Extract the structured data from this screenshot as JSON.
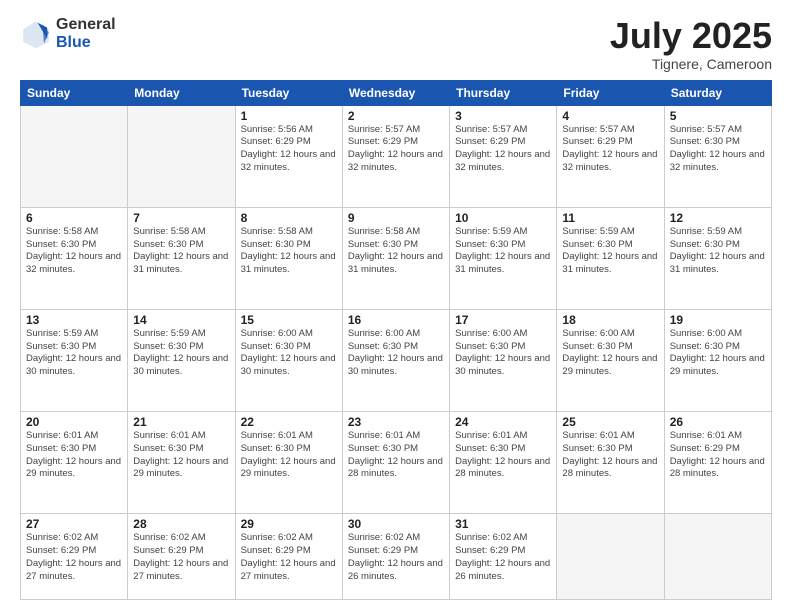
{
  "logo": {
    "general": "General",
    "blue": "Blue"
  },
  "header": {
    "month": "July 2025",
    "location": "Tignere, Cameroon"
  },
  "weekdays": [
    "Sunday",
    "Monday",
    "Tuesday",
    "Wednesday",
    "Thursday",
    "Friday",
    "Saturday"
  ],
  "weeks": [
    [
      {
        "day": "",
        "sunrise": "",
        "sunset": "",
        "daylight": ""
      },
      {
        "day": "",
        "sunrise": "",
        "sunset": "",
        "daylight": ""
      },
      {
        "day": "1",
        "sunrise": "Sunrise: 5:56 AM",
        "sunset": "Sunset: 6:29 PM",
        "daylight": "Daylight: 12 hours and 32 minutes."
      },
      {
        "day": "2",
        "sunrise": "Sunrise: 5:57 AM",
        "sunset": "Sunset: 6:29 PM",
        "daylight": "Daylight: 12 hours and 32 minutes."
      },
      {
        "day": "3",
        "sunrise": "Sunrise: 5:57 AM",
        "sunset": "Sunset: 6:29 PM",
        "daylight": "Daylight: 12 hours and 32 minutes."
      },
      {
        "day": "4",
        "sunrise": "Sunrise: 5:57 AM",
        "sunset": "Sunset: 6:29 PM",
        "daylight": "Daylight: 12 hours and 32 minutes."
      },
      {
        "day": "5",
        "sunrise": "Sunrise: 5:57 AM",
        "sunset": "Sunset: 6:30 PM",
        "daylight": "Daylight: 12 hours and 32 minutes."
      }
    ],
    [
      {
        "day": "6",
        "sunrise": "Sunrise: 5:58 AM",
        "sunset": "Sunset: 6:30 PM",
        "daylight": "Daylight: 12 hours and 32 minutes."
      },
      {
        "day": "7",
        "sunrise": "Sunrise: 5:58 AM",
        "sunset": "Sunset: 6:30 PM",
        "daylight": "Daylight: 12 hours and 31 minutes."
      },
      {
        "day": "8",
        "sunrise": "Sunrise: 5:58 AM",
        "sunset": "Sunset: 6:30 PM",
        "daylight": "Daylight: 12 hours and 31 minutes."
      },
      {
        "day": "9",
        "sunrise": "Sunrise: 5:58 AM",
        "sunset": "Sunset: 6:30 PM",
        "daylight": "Daylight: 12 hours and 31 minutes."
      },
      {
        "day": "10",
        "sunrise": "Sunrise: 5:59 AM",
        "sunset": "Sunset: 6:30 PM",
        "daylight": "Daylight: 12 hours and 31 minutes."
      },
      {
        "day": "11",
        "sunrise": "Sunrise: 5:59 AM",
        "sunset": "Sunset: 6:30 PM",
        "daylight": "Daylight: 12 hours and 31 minutes."
      },
      {
        "day": "12",
        "sunrise": "Sunrise: 5:59 AM",
        "sunset": "Sunset: 6:30 PM",
        "daylight": "Daylight: 12 hours and 31 minutes."
      }
    ],
    [
      {
        "day": "13",
        "sunrise": "Sunrise: 5:59 AM",
        "sunset": "Sunset: 6:30 PM",
        "daylight": "Daylight: 12 hours and 30 minutes."
      },
      {
        "day": "14",
        "sunrise": "Sunrise: 5:59 AM",
        "sunset": "Sunset: 6:30 PM",
        "daylight": "Daylight: 12 hours and 30 minutes."
      },
      {
        "day": "15",
        "sunrise": "Sunrise: 6:00 AM",
        "sunset": "Sunset: 6:30 PM",
        "daylight": "Daylight: 12 hours and 30 minutes."
      },
      {
        "day": "16",
        "sunrise": "Sunrise: 6:00 AM",
        "sunset": "Sunset: 6:30 PM",
        "daylight": "Daylight: 12 hours and 30 minutes."
      },
      {
        "day": "17",
        "sunrise": "Sunrise: 6:00 AM",
        "sunset": "Sunset: 6:30 PM",
        "daylight": "Daylight: 12 hours and 30 minutes."
      },
      {
        "day": "18",
        "sunrise": "Sunrise: 6:00 AM",
        "sunset": "Sunset: 6:30 PM",
        "daylight": "Daylight: 12 hours and 29 minutes."
      },
      {
        "day": "19",
        "sunrise": "Sunrise: 6:00 AM",
        "sunset": "Sunset: 6:30 PM",
        "daylight": "Daylight: 12 hours and 29 minutes."
      }
    ],
    [
      {
        "day": "20",
        "sunrise": "Sunrise: 6:01 AM",
        "sunset": "Sunset: 6:30 PM",
        "daylight": "Daylight: 12 hours and 29 minutes."
      },
      {
        "day": "21",
        "sunrise": "Sunrise: 6:01 AM",
        "sunset": "Sunset: 6:30 PM",
        "daylight": "Daylight: 12 hours and 29 minutes."
      },
      {
        "day": "22",
        "sunrise": "Sunrise: 6:01 AM",
        "sunset": "Sunset: 6:30 PM",
        "daylight": "Daylight: 12 hours and 29 minutes."
      },
      {
        "day": "23",
        "sunrise": "Sunrise: 6:01 AM",
        "sunset": "Sunset: 6:30 PM",
        "daylight": "Daylight: 12 hours and 28 minutes."
      },
      {
        "day": "24",
        "sunrise": "Sunrise: 6:01 AM",
        "sunset": "Sunset: 6:30 PM",
        "daylight": "Daylight: 12 hours and 28 minutes."
      },
      {
        "day": "25",
        "sunrise": "Sunrise: 6:01 AM",
        "sunset": "Sunset: 6:30 PM",
        "daylight": "Daylight: 12 hours and 28 minutes."
      },
      {
        "day": "26",
        "sunrise": "Sunrise: 6:01 AM",
        "sunset": "Sunset: 6:29 PM",
        "daylight": "Daylight: 12 hours and 28 minutes."
      }
    ],
    [
      {
        "day": "27",
        "sunrise": "Sunrise: 6:02 AM",
        "sunset": "Sunset: 6:29 PM",
        "daylight": "Daylight: 12 hours and 27 minutes."
      },
      {
        "day": "28",
        "sunrise": "Sunrise: 6:02 AM",
        "sunset": "Sunset: 6:29 PM",
        "daylight": "Daylight: 12 hours and 27 minutes."
      },
      {
        "day": "29",
        "sunrise": "Sunrise: 6:02 AM",
        "sunset": "Sunset: 6:29 PM",
        "daylight": "Daylight: 12 hours and 27 minutes."
      },
      {
        "day": "30",
        "sunrise": "Sunrise: 6:02 AM",
        "sunset": "Sunset: 6:29 PM",
        "daylight": "Daylight: 12 hours and 26 minutes."
      },
      {
        "day": "31",
        "sunrise": "Sunrise: 6:02 AM",
        "sunset": "Sunset: 6:29 PM",
        "daylight": "Daylight: 12 hours and 26 minutes."
      },
      {
        "day": "",
        "sunrise": "",
        "sunset": "",
        "daylight": ""
      },
      {
        "day": "",
        "sunrise": "",
        "sunset": "",
        "daylight": ""
      }
    ]
  ]
}
